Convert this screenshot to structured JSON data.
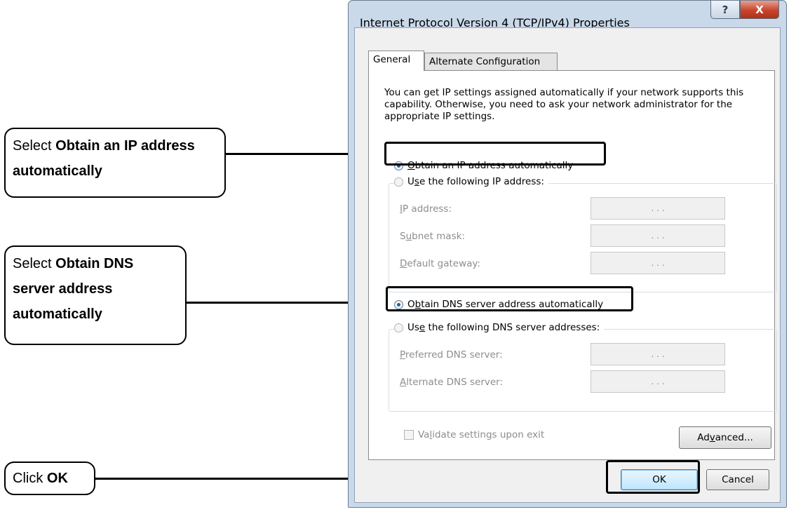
{
  "dialog": {
    "title": "Internet Protocol Version 4 (TCP/IPv4) Properties",
    "help_glyph": "?",
    "close_glyph": "X",
    "tabs": [
      {
        "label": "General",
        "active": true
      },
      {
        "label": "Alternate Configuration",
        "active": false
      }
    ],
    "description": "You can get IP settings assigned automatically if your network supports this capability. Otherwise, you need to ask your network administrator for the appropriate IP settings.",
    "ip_auto": {
      "label_pre": "",
      "mnemonic": "O",
      "label_post": "btain an IP address automatically",
      "checked": true
    },
    "ip_manual": {
      "label_pre": "U",
      "mnemonic": "s",
      "label_post": "e the following IP address:",
      "checked": false
    },
    "ip_fields": [
      {
        "pre": "",
        "mn": "I",
        "post": "P address:",
        "value": ".       .       ."
      },
      {
        "pre": "S",
        "mn": "u",
        "post": "bnet mask:",
        "value": ".       .       ."
      },
      {
        "pre": "",
        "mn": "D",
        "post": "efault gateway:",
        "value": ".       .       ."
      }
    ],
    "dns_auto": {
      "label_pre": "O",
      "mnemonic": "b",
      "label_post": "tain DNS server address automatically",
      "checked": true
    },
    "dns_manual": {
      "label_pre": "Us",
      "mnemonic": "e",
      "label_post": " the following DNS server addresses:",
      "checked": false
    },
    "dns_fields": [
      {
        "pre": "",
        "mn": "P",
        "post": "referred DNS server:",
        "value": ".       .       ."
      },
      {
        "pre": "",
        "mn": "A",
        "post": "lternate DNS server:",
        "value": ".       .       ."
      }
    ],
    "validate": {
      "pre": "Va",
      "mn": "l",
      "post": "idate settings upon exit",
      "checked": false
    },
    "advanced": {
      "pre": "Ad",
      "mn": "v",
      "post": "anced..."
    },
    "ok_label": "OK",
    "cancel_label": "Cancel"
  },
  "callouts": {
    "ip": {
      "prefix": "Select ",
      "bold": "Obtain an IP address automatically"
    },
    "dns": {
      "prefix": "Select ",
      "bold": "Obtain DNS server address automatically"
    },
    "ok": {
      "prefix": "Click ",
      "bold": "OK"
    }
  }
}
